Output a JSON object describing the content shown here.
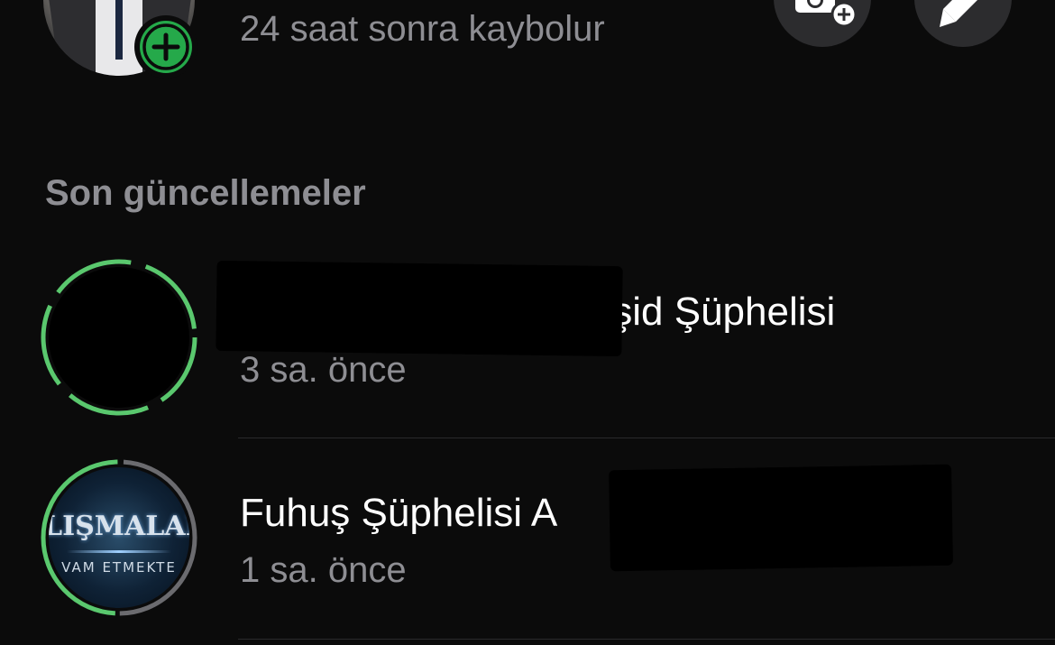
{
  "my_status": {
    "subtitle": "24 saat sonra kaybolur"
  },
  "section": {
    "title": "Son güncellemeler"
  },
  "updates": [
    {
      "name_visible": "İşid Şüphelisi",
      "time": "3 sa. önce",
      "ring_color": "#5ac86e",
      "viewed_segments": 0
    },
    {
      "name_visible": "Fuhuş Şüphelisi A",
      "time": "1 sa. önce",
      "ring_color": "#5ac86e",
      "viewed_ring_color": "#6b6b6f",
      "banner_line1": "LIŞMALARI",
      "banner_line2": "VAM ETMEKTE"
    }
  ],
  "colors": {
    "background": "#0b0b0b",
    "accent_green": "#25a94a",
    "secondary_text": "#8e8e93",
    "button_bg": "#2c2c2e"
  },
  "icons": {
    "add_status": "plus-icon",
    "camera": "camera-plus-icon",
    "pencil": "pencil-icon"
  }
}
